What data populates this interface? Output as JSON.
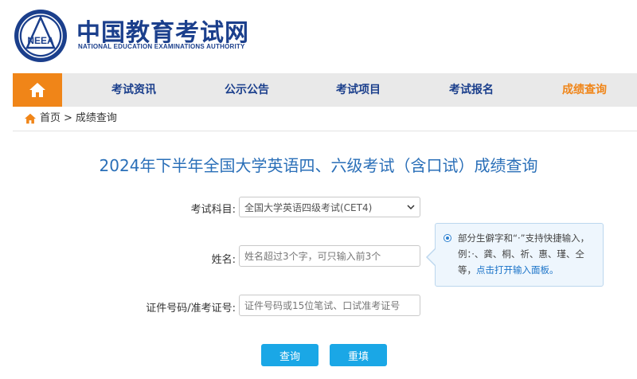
{
  "brand": {
    "title_cn": "中国教育考试网",
    "title_en": "NATIONAL EDUCATION EXAMINATIONS AUTHORITY",
    "logo_text": "NEEA",
    "logo_color": "#1b3f8c"
  },
  "nav": {
    "home_icon": "home-icon",
    "items": [
      {
        "label": "考试资讯"
      },
      {
        "label": "公示公告"
      },
      {
        "label": "考试项目"
      },
      {
        "label": "考试报名"
      },
      {
        "label": "成绩查询"
      }
    ],
    "active_index": 4,
    "active_color": "#f08518"
  },
  "breadcrumb": {
    "home": "首页",
    "separator": ">",
    "current": "成绩查询"
  },
  "page_title": "2024年下半年全国大学英语四、六级考试（含口试）成绩查询",
  "form": {
    "subject_label": "考试科目:",
    "subject_value": "全国大学英语四级考试(CET4)",
    "name_label": "姓名:",
    "name_placeholder": "姓名超过3个字，可只输入前3个",
    "id_label": "证件号码/准考证号:",
    "id_placeholder": "证件号码或15位笔试、口试准考证号"
  },
  "tip": {
    "text": "部分生僻字和“·”支持快捷输入，例：·、龚、桐、祈、惠、瑾、仝等，",
    "link": "点击打开输入面板。"
  },
  "buttons": {
    "query": "查询",
    "reset": "重填",
    "color": "#1aa7e6"
  }
}
